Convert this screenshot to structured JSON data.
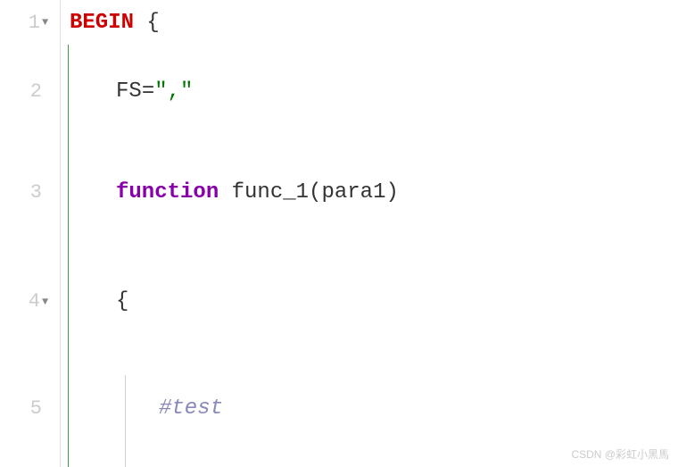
{
  "gutter": {
    "lines": [
      {
        "num": "1",
        "fold": true
      },
      {
        "num": "2",
        "fold": false
      },
      {
        "num": "3",
        "fold": false
      },
      {
        "num": "4",
        "fold": true
      },
      {
        "num": "5",
        "fold": false
      }
    ]
  },
  "code": {
    "line1": {
      "keyword": "BEGIN",
      "space": " ",
      "brace": "{"
    },
    "line2": {
      "ident": "FS",
      "eq": "=",
      "str": "\",\""
    },
    "line3": {
      "kw": "function",
      "space": " ",
      "name": "func_1",
      "lparen": "(",
      "param": "para1",
      "rparen": ")"
    },
    "line4": {
      "brace": "{"
    },
    "line5": {
      "comment": "#test"
    }
  },
  "watermark": "CSDN @彩虹小黑馬"
}
